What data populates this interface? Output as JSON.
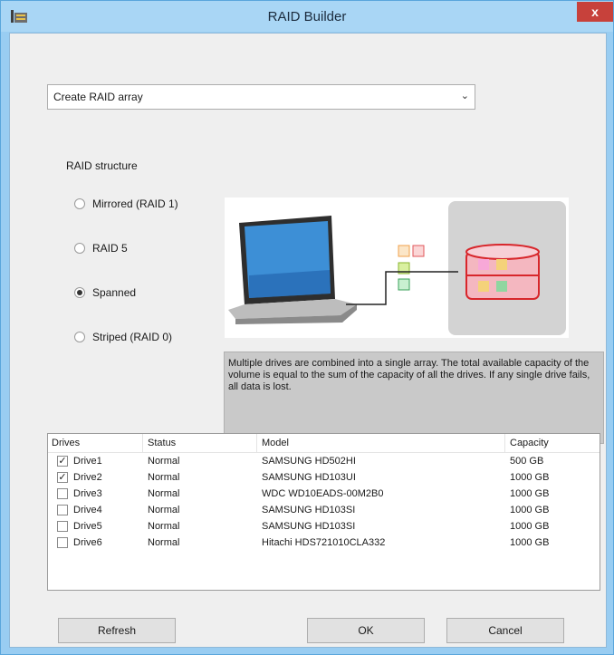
{
  "window": {
    "title": "RAID Builder",
    "close_glyph": "x"
  },
  "mode": {
    "selected": "Create RAID array"
  },
  "raid_structure": {
    "label": "RAID structure",
    "options": [
      {
        "label": "Mirrored (RAID 1)",
        "selected": false
      },
      {
        "label": "RAID 5",
        "selected": false
      },
      {
        "label": "Spanned",
        "selected": true
      },
      {
        "label": "Striped (RAID 0)",
        "selected": false
      }
    ],
    "description": "Multiple drives are combined into a single array. The total available capacity of the volume is equal to the sum of the capacity of all the drives. If any single drive fails, all data is lost."
  },
  "drives": {
    "columns": [
      "Drives",
      "Status",
      "Model",
      "Capacity"
    ],
    "rows": [
      {
        "checked": true,
        "drive": "Drive1",
        "status": "Normal",
        "model": "SAMSUNG HD502HI",
        "capacity": "500 GB"
      },
      {
        "checked": true,
        "drive": "Drive2",
        "status": "Normal",
        "model": "SAMSUNG HD103UI",
        "capacity": "1000 GB"
      },
      {
        "checked": false,
        "drive": "Drive3",
        "status": "Normal",
        "model": "WDC WD10EADS-00M2B0",
        "capacity": "1000 GB"
      },
      {
        "checked": false,
        "drive": "Drive4",
        "status": "Normal",
        "model": "SAMSUNG HD103SI",
        "capacity": "1000 GB"
      },
      {
        "checked": false,
        "drive": "Drive5",
        "status": "Normal",
        "model": "SAMSUNG HD103SI",
        "capacity": "1000 GB"
      },
      {
        "checked": false,
        "drive": "Drive6",
        "status": "Normal",
        "model": "Hitachi HDS721010CLA332",
        "capacity": "1000 GB"
      }
    ]
  },
  "buttons": {
    "refresh": "Refresh",
    "ok": "OK",
    "cancel": "Cancel"
  },
  "colors": {
    "titlebar": "#a9d6f5",
    "close": "#c7413b",
    "accent_red": "#d8262b"
  }
}
